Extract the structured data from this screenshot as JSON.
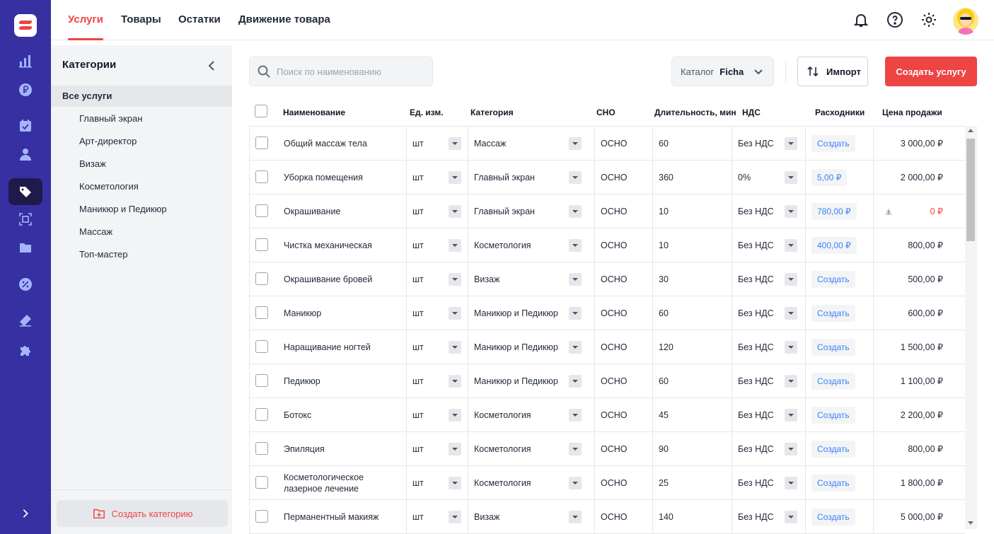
{
  "nav": {
    "tabs": [
      "Услуги",
      "Товары",
      "Остатки",
      "Движение товара"
    ],
    "active_tab": "Услуги"
  },
  "rail_icons": [
    "chart-icon",
    "ruble-icon",
    "calendar-icon",
    "user-icon",
    "tag-icon",
    "scan-icon",
    "folder-icon",
    "percent-icon",
    "ticket-icon",
    "puzzle-icon"
  ],
  "sidebar": {
    "title": "Категории",
    "items": [
      "Все услуги",
      "Главный экран",
      "Арт-директор",
      "Визаж",
      "Косметология",
      "Маникюр и Педикюр",
      "Массаж",
      "Топ-мастер"
    ],
    "active": "Все услуги",
    "create_label": "Создать категорию"
  },
  "toolbar": {
    "search_placeholder": "Поиск по наименованию",
    "catalog_label": "Каталог",
    "catalog_value": "Ficha",
    "import_label": "Импорт",
    "create_label": "Создать услугу"
  },
  "table": {
    "columns": [
      "Наименование",
      "Ед. изм.",
      "Категория",
      "СНО",
      "Длительность, мин",
      "НДС",
      "Расходники",
      "Цена продажи"
    ],
    "rows": [
      {
        "name": "Общий массаж тела",
        "unit": "шт",
        "category": "Массаж",
        "sno": "ОСНО",
        "duration": "60",
        "vat": "Без НДС",
        "supplies": "Создать",
        "price": "3 000,00 ₽"
      },
      {
        "name": "Уборка помещения",
        "unit": "шт",
        "category": "Главный экран",
        "sno": "ОСНО",
        "duration": "360",
        "vat": "0%",
        "supplies": "5,00 ₽",
        "price": "2 000,00 ₽"
      },
      {
        "name": "Окрашивание",
        "unit": "шт",
        "category": "Главный экран",
        "sno": "ОСНО",
        "duration": "10",
        "vat": "Без НДС",
        "supplies": "780,00 ₽",
        "price": "0 ₽",
        "warning": true
      },
      {
        "name": "Чистка механическая",
        "unit": "шт",
        "category": "Косметология",
        "sno": "ОСНО",
        "duration": "10",
        "vat": "Без НДС",
        "supplies": "400,00 ₽",
        "price": "800,00 ₽"
      },
      {
        "name": "Окрашивание бровей",
        "unit": "шт",
        "category": "Визаж",
        "sno": "ОСНО",
        "duration": "30",
        "vat": "Без НДС",
        "supplies": "Создать",
        "price": "500,00 ₽"
      },
      {
        "name": "Маникюр",
        "unit": "шт",
        "category": "Маникюр и Педикюр",
        "sno": "ОСНО",
        "duration": "60",
        "vat": "Без НДС",
        "supplies": "Создать",
        "price": "600,00 ₽"
      },
      {
        "name": "Наращивание ногтей",
        "unit": "шт",
        "category": "Маникюр и Педикюр",
        "sno": "ОСНО",
        "duration": "120",
        "vat": "Без НДС",
        "supplies": "Создать",
        "price": "1 500,00 ₽"
      },
      {
        "name": "Педикюр",
        "unit": "шт",
        "category": "Маникюр и Педикюр",
        "sno": "ОСНО",
        "duration": "60",
        "vat": "Без НДС",
        "supplies": "Создать",
        "price": "1 100,00 ₽"
      },
      {
        "name": "Ботокс",
        "unit": "шт",
        "category": "Косметология",
        "sno": "ОСНО",
        "duration": "45",
        "vat": "Без НДС",
        "supplies": "Создать",
        "price": "2 200,00 ₽"
      },
      {
        "name": "Эпиляция",
        "unit": "шт",
        "category": "Косметология",
        "sno": "ОСНО",
        "duration": "90",
        "vat": "Без НДС",
        "supplies": "Создать",
        "price": "800,00 ₽"
      },
      {
        "name": "Косметологическое лазерное лечение",
        "unit": "шт",
        "category": "Косметология",
        "sno": "ОСНО",
        "duration": "25",
        "vat": "Без НДС",
        "supplies": "Создать",
        "price": "1 800,00 ₽"
      },
      {
        "name": "Перманентный макияж",
        "unit": "шт",
        "category": "Визаж",
        "sno": "ОСНО",
        "duration": "140",
        "vat": "Без НДС",
        "supplies": "Создать",
        "price": "5 000,00 ₽"
      }
    ]
  },
  "colors": {
    "accent": "#ef4444",
    "rail": "#3730a3",
    "link": "#3b82f6"
  }
}
